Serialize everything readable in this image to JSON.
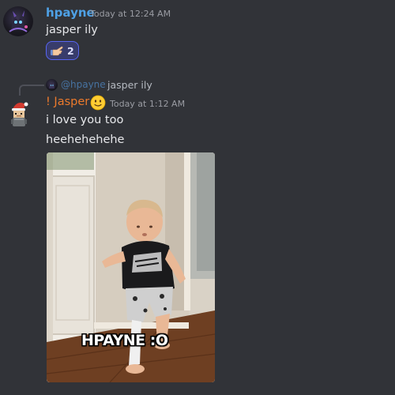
{
  "messages": [
    {
      "author": "hpayne",
      "timestamp": "Today at 12:24 AM",
      "text": "jasper ily",
      "reactions": [
        {
          "emoji": "pointing-hand-emoji",
          "count": "2"
        }
      ]
    },
    {
      "reply": {
        "mention": "@hpayne",
        "text": "jasper ily"
      },
      "author": "! Jasper",
      "author_emoji": "slightly-smiling-face-emoji",
      "timestamp": "Today at 1:12 AM",
      "lines": [
        "i love you too",
        "heehehehehe"
      ],
      "gif": {
        "caption": "HPAYNE :O"
      }
    }
  ],
  "colors": {
    "background": "#313338",
    "username_hpayne": "#4ea1e6",
    "username_jasper": "#ed7a2c",
    "reaction_border": "#5865f2",
    "timestamp": "#9a9ca3"
  }
}
